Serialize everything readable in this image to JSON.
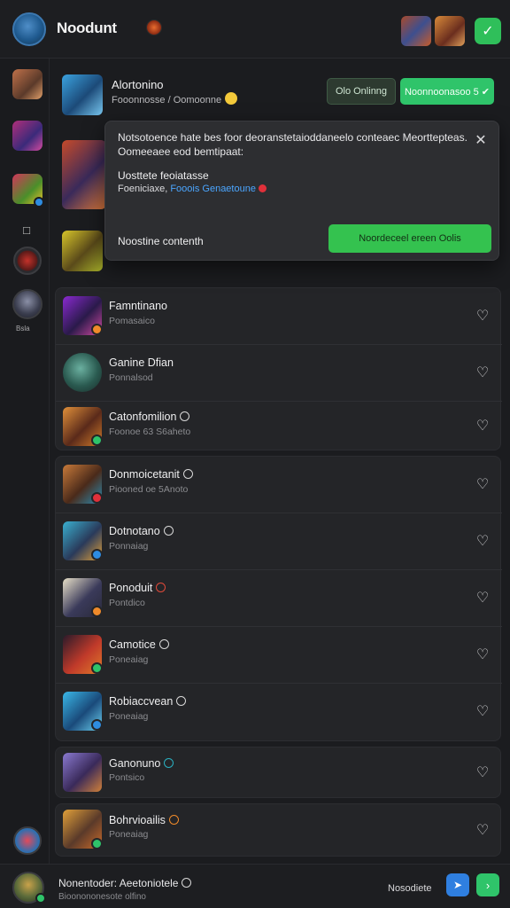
{
  "header": {
    "title": "Noodunt",
    "add_icon": "plus-icon"
  },
  "rail": {
    "label": "Bsla"
  },
  "featured": {
    "title": "Alortonino",
    "subtitle": "Fooonnosse / Oomoonne",
    "ghost_button": "Olo Onlinng",
    "green_button": "Noonnoonasoo 5 ✔"
  },
  "popover": {
    "text": "Notsotoence hate bes foor deoranstetaioddaneelo conteaec Meorttepteas. Oomeeaee eod bemtipaat:",
    "label": "Uosttete feoiatasse",
    "link_prefix": "Foeniciaxe,",
    "link_blue": "Fooois Genaetoune",
    "footer": "Noostine contenth",
    "cta": "Noordeceel ereen Oolis"
  },
  "rows": [
    {
      "name": "Famntinano",
      "sub": "Pomasaico",
      "glyph": false,
      "badge": "#f08a2a"
    },
    {
      "name": "Ganine Dfian",
      "sub": "Ponnalsod",
      "glyph": false,
      "badge": ""
    },
    {
      "name": "Catonfomilion",
      "sub": "Foonoe 63 S6aheto",
      "glyph": true,
      "badge": "#2fc46a"
    },
    {
      "name": "Donmoicetanit",
      "sub": "Piooned oe 5Anoto",
      "glyph": true,
      "badge": "#e0303a"
    },
    {
      "name": "Dotnotano",
      "sub": "Ponnaiag",
      "glyph": true,
      "badge": "#2e8ce0"
    },
    {
      "name": "Ponoduit",
      "sub": "Pontdico",
      "glyph": true,
      "badge": "#f08a2a"
    },
    {
      "name": "Camotice",
      "sub": "Poneaiag",
      "glyph": true,
      "badge": "#2fc46a"
    },
    {
      "name": "Robiaccvean",
      "sub": "Poneaiag",
      "glyph": true,
      "badge": "#2e8ce0"
    },
    {
      "name": "Ganonuno",
      "sub": "Pontsico",
      "glyph": true,
      "badge": ""
    },
    {
      "name": "Bohrvioailis",
      "sub": "Poneaiag",
      "glyph": true,
      "badge": "#2fc46a"
    }
  ],
  "bottom": {
    "title": "Nonentoder: Aeetoniotele",
    "sub": "Bioonononesote olfino",
    "status": "Nosodiete"
  },
  "colors": {
    "accent_green": "#2fc46a",
    "accent_blue": "#2f7fe0",
    "background": "#1b1c1f"
  }
}
